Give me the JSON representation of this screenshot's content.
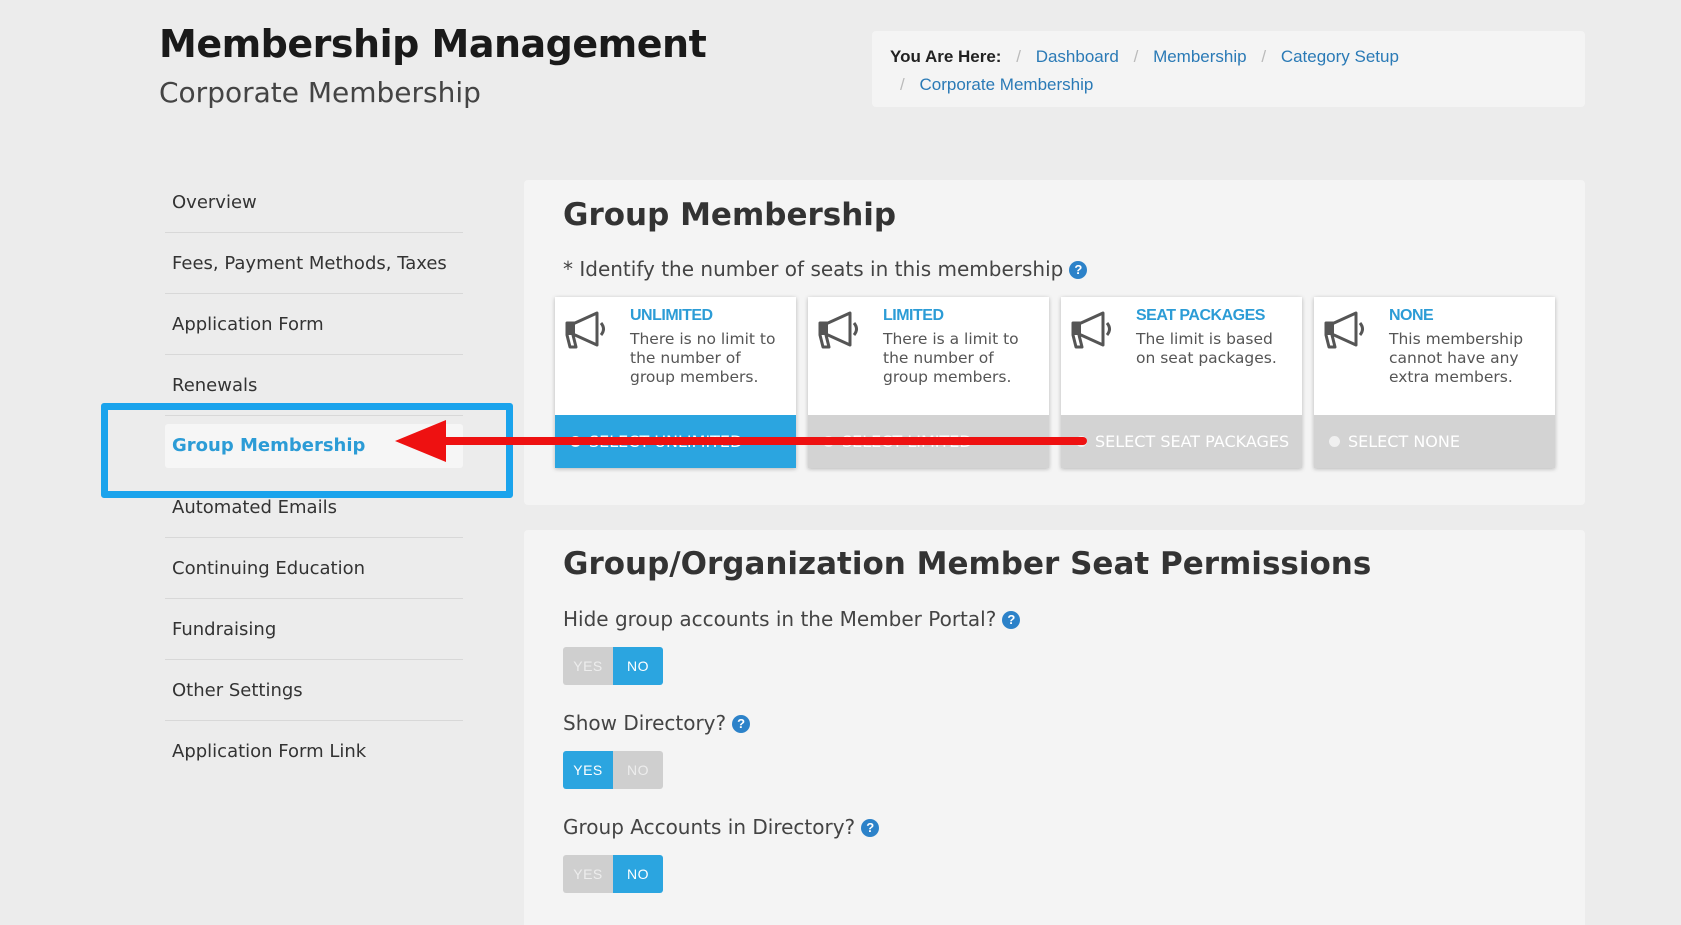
{
  "header": {
    "title": "Membership Management",
    "subtitle": "Corporate Membership"
  },
  "breadcrumb": {
    "label": "You Are Here:",
    "items": [
      "Dashboard",
      "Membership",
      "Category Setup",
      "Corporate Membership"
    ]
  },
  "sidebar": {
    "items": [
      {
        "label": "Overview"
      },
      {
        "label": "Fees, Payment Methods, Taxes"
      },
      {
        "label": "Application Form"
      },
      {
        "label": "Renewals"
      },
      {
        "label": "Group Membership",
        "active": true
      },
      {
        "label": "Automated Emails"
      },
      {
        "label": "Continuing Education"
      },
      {
        "label": "Fundraising"
      },
      {
        "label": "Other Settings"
      },
      {
        "label": "Application Form Link"
      }
    ]
  },
  "group_membership": {
    "title": "Group Membership",
    "prompt": "* Identify the number of seats in this membership",
    "options": [
      {
        "title": "UNLIMITED",
        "description": "There is no limit to the number of group members.",
        "button": "SELECT UNLIMITED",
        "selected": true
      },
      {
        "title": "LIMITED",
        "description": "There is a limit to the number of group members.",
        "button": "SELECT LIMITED",
        "selected": false
      },
      {
        "title": "SEAT PACKAGES",
        "description": "The limit is based on seat packages.",
        "button": "SELECT SEAT PACKAGES",
        "selected": false
      },
      {
        "title": "NONE",
        "description": "This membership cannot have any extra members.",
        "button": "SELECT NONE",
        "selected": false
      }
    ]
  },
  "seat_permissions": {
    "title": "Group/Organization Member Seat Permissions",
    "questions": [
      {
        "label": "Hide group accounts in the Member Portal?",
        "yes": "YES",
        "no": "NO",
        "value": "NO"
      },
      {
        "label": "Show Directory?",
        "yes": "YES",
        "no": "NO",
        "value": "YES"
      },
      {
        "label": "Group Accounts in Directory?",
        "yes": "YES",
        "no": "NO",
        "value": "NO"
      }
    ]
  },
  "annotation": {
    "highlight_color": "#1aa3ec",
    "arrow_color": "#ee1111"
  }
}
